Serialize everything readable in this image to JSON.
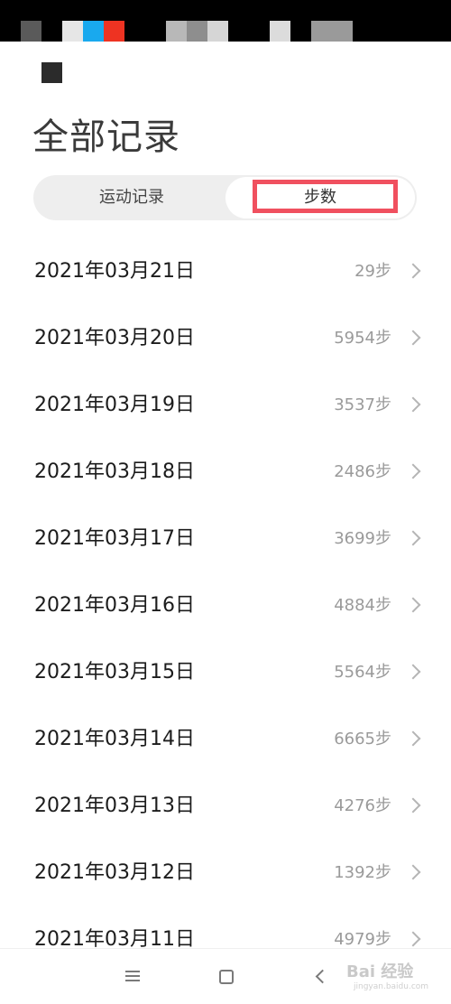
{
  "header": {
    "title": "全部记录"
  },
  "tabs": [
    {
      "label": "运动记录",
      "selected": false
    },
    {
      "label": "步数",
      "selected": true
    }
  ],
  "records": [
    {
      "date": "2021年03月21日",
      "steps": "29步"
    },
    {
      "date": "2021年03月20日",
      "steps": "5954步"
    },
    {
      "date": "2021年03月19日",
      "steps": "3537步"
    },
    {
      "date": "2021年03月18日",
      "steps": "2486步"
    },
    {
      "date": "2021年03月17日",
      "steps": "3699步"
    },
    {
      "date": "2021年03月16日",
      "steps": "4884步"
    },
    {
      "date": "2021年03月15日",
      "steps": "5564步"
    },
    {
      "date": "2021年03月14日",
      "steps": "6665步"
    },
    {
      "date": "2021年03月13日",
      "steps": "4276步"
    },
    {
      "date": "2021年03月12日",
      "steps": "1392步"
    },
    {
      "date": "2021年03月11日",
      "steps": "4979步"
    }
  ],
  "icons": {
    "back": "back-icon",
    "chevron": "chevron-right-icon",
    "nav_menu": "menu-icon",
    "nav_home": "home-icon",
    "nav_back": "back-triangle-icon"
  },
  "colors": {
    "highlight": "#f0505f",
    "tab_bg": "#eeeeee",
    "secondary_text": "#9a9a9a"
  },
  "watermark": {
    "text": "Bai 经验",
    "sub": "jingyan.baidu.com"
  }
}
